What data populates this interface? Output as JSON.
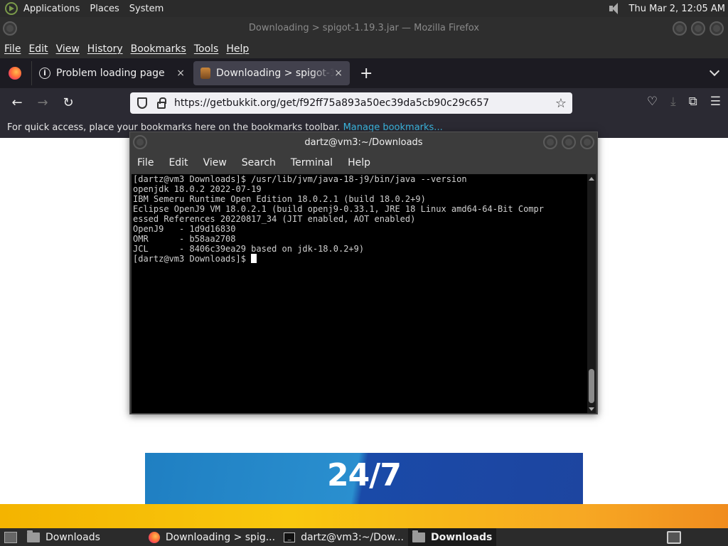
{
  "top_panel": {
    "menus": [
      "Applications",
      "Places",
      "System"
    ],
    "clock": "Thu Mar  2, 12:05 AM"
  },
  "firefox": {
    "window_title": "Downloading > spigot-1.19.3.jar — Mozilla Firefox",
    "menu": [
      "File",
      "Edit",
      "View",
      "History",
      "Bookmarks",
      "Tools",
      "Help"
    ],
    "tabs": [
      {
        "label": "Problem loading page",
        "close": "×"
      },
      {
        "label": "Downloading > spigot-1.19.3.jar",
        "close": "×"
      }
    ],
    "new_tab": "+",
    "url": "https://getbukkit.org/get/f92ff75a893a50ec39da5cb90c29c657",
    "bookmarks_hint": "For quick access, place your bookmarks here on the bookmarks toolbar.",
    "manage_bookmarks": "Manage bookmarks..."
  },
  "terminal": {
    "title": "dartz@vm3:~/Downloads",
    "menu": [
      "File",
      "Edit",
      "View",
      "Search",
      "Terminal",
      "Help"
    ],
    "lines": [
      "[dartz@vm3 Downloads]$ /usr/lib/jvm/java-18-j9/bin/java --version",
      "openjdk 18.0.2 2022-07-19",
      "IBM Semeru Runtime Open Edition 18.0.2.1 (build 18.0.2+9)",
      "Eclipse OpenJ9 VM 18.0.2.1 (build openj9-0.33.1, JRE 18 Linux amd64-64-Bit Compr",
      "essed References 20220817_34 (JIT enabled, AOT enabled)",
      "OpenJ9   - 1d9d16830",
      "OMR      - b58aa2708",
      "JCL      - 8406c39ea29 based on jdk-18.0.2+9)"
    ],
    "prompt": "[dartz@vm3 Downloads]$ "
  },
  "page": {
    "banner_text": "24/7"
  },
  "taskbar": {
    "items": [
      {
        "label": "Downloads",
        "icon": "folder-icon"
      },
      {
        "label": "Downloading > spig...",
        "icon": "firefox-icon"
      },
      {
        "label": "dartz@vm3:~/Dow...",
        "icon": "terminal-icon"
      },
      {
        "label": "Downloads",
        "icon": "folder-icon"
      }
    ]
  }
}
